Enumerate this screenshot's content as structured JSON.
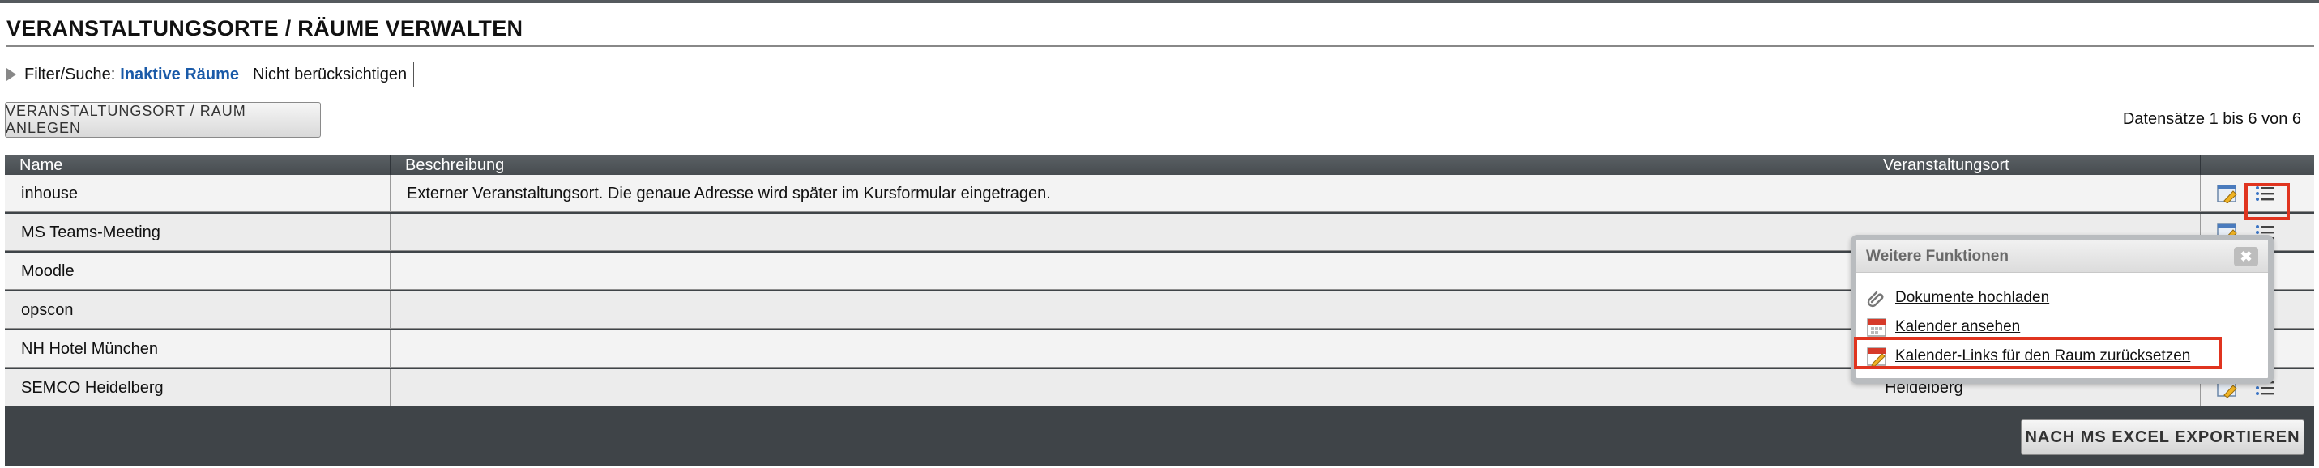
{
  "page": {
    "title": "VERANSTALTUNGSORTE / RÄUME VERWALTEN"
  },
  "filter": {
    "label": "Filter/Suche:",
    "value": "Inaktive Räume",
    "select_value": "Nicht berücksichtigen"
  },
  "toolbar": {
    "create_label": "VERANSTALTUNGSORT / RAUM ANLEGEN",
    "record_count": "Datensätze 1 bis 6 von 6"
  },
  "table": {
    "columns": [
      "Name",
      "Beschreibung",
      "Veranstaltungsort",
      ""
    ],
    "rows": [
      {
        "name": "inhouse",
        "description": "Externer Veranstaltungsort. Die genaue Adresse wird später im Kursformular eingetragen.",
        "location": ""
      },
      {
        "name": "MS Teams-Meeting",
        "description": "",
        "location": ""
      },
      {
        "name": "Moodle",
        "description": "",
        "location": ""
      },
      {
        "name": "opscon",
        "description": "",
        "location": ""
      },
      {
        "name": "NH Hotel München",
        "description": "",
        "location": ""
      },
      {
        "name": "SEMCO Heidelberg",
        "description": "",
        "location": "Heidelberg"
      }
    ],
    "export_label": "NACH MS EXCEL EXPORTIEREN"
  },
  "popup": {
    "title": "Weitere Funktionen",
    "close_symbol": "✖",
    "items": [
      {
        "label": "Dokumente hochladen",
        "icon": "paperclip-icon"
      },
      {
        "label": "Kalender ansehen",
        "icon": "calendar-icon"
      },
      {
        "label": "Kalender-Links für den Raum zurücksetzen",
        "icon": "calendar-edit-icon"
      }
    ]
  },
  "colors": {
    "accent_link": "#1a5aa8",
    "header_bg": "#4f5458",
    "highlight": "#e0341f"
  }
}
